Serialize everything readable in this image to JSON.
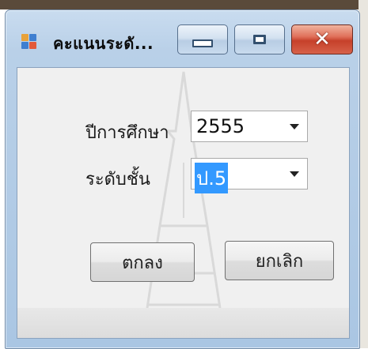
{
  "window": {
    "title": "คะแนนระดั..."
  },
  "form": {
    "year_label": "ปีการศึกษา",
    "year_value": "2555",
    "level_label": "ระดับชั้น",
    "level_value": "ป.5"
  },
  "buttons": {
    "ok_label": "ตกลง",
    "cancel_label": "ยกเลิก"
  },
  "colors": {
    "selection": "#3399ff",
    "close_button": "#c6402a",
    "window_frame": "#aac6e3"
  },
  "icons": {
    "app": "app-icon",
    "minimize": "minimize-icon",
    "maximize": "maximize-icon",
    "close": "close-icon",
    "dropdown": "chevron-down-icon"
  }
}
